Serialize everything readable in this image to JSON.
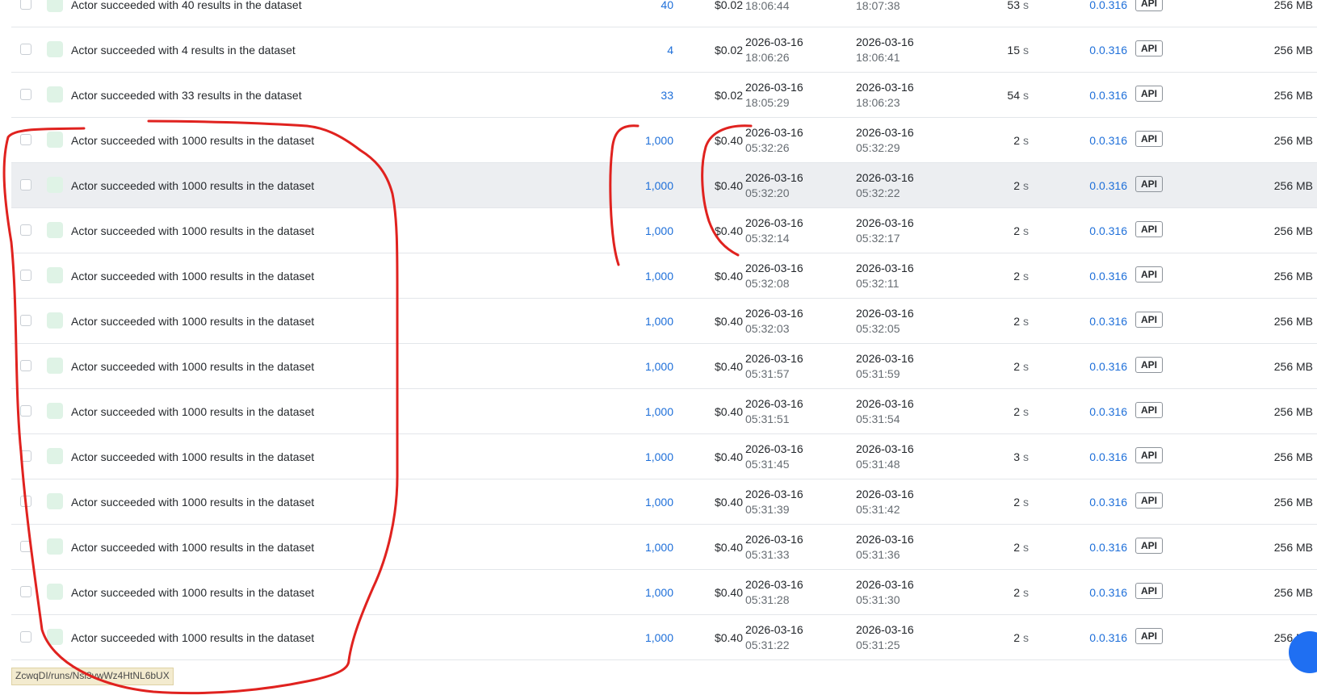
{
  "runs": [
    {
      "status": "Actor succeeded with 40 results in the dataset",
      "results": "40",
      "cost": "$0.02",
      "started_date": "",
      "started_time": "18:06:44",
      "finished_date": "",
      "finished_time": "18:07:38",
      "duration": "53",
      "duration_unit": "s",
      "build": "0.0.316",
      "origin": "API",
      "memory": "256 MB"
    },
    {
      "status": "Actor succeeded with 4 results in the dataset",
      "results": "4",
      "cost": "$0.02",
      "started_date": "2026-03-16",
      "started_time": "18:06:26",
      "finished_date": "2026-03-16",
      "finished_time": "18:06:41",
      "duration": "15",
      "duration_unit": "s",
      "build": "0.0.316",
      "origin": "API",
      "memory": "256 MB"
    },
    {
      "status": "Actor succeeded with 33 results in the dataset",
      "results": "33",
      "cost": "$0.02",
      "started_date": "2026-03-16",
      "started_time": "18:05:29",
      "finished_date": "2026-03-16",
      "finished_time": "18:06:23",
      "duration": "54",
      "duration_unit": "s",
      "build": "0.0.316",
      "origin": "API",
      "memory": "256 MB"
    },
    {
      "status": "Actor succeeded with 1000 results in the dataset",
      "results": "1,000",
      "cost": "$0.40",
      "started_date": "2026-03-16",
      "started_time": "05:32:26",
      "finished_date": "2026-03-16",
      "finished_time": "05:32:29",
      "duration": "2",
      "duration_unit": "s",
      "build": "0.0.316",
      "origin": "API",
      "memory": "256 MB"
    },
    {
      "status": "Actor succeeded with 1000 results in the dataset",
      "results": "1,000",
      "cost": "$0.40",
      "started_date": "2026-03-16",
      "started_time": "05:32:20",
      "finished_date": "2026-03-16",
      "finished_time": "05:32:22",
      "duration": "2",
      "duration_unit": "s",
      "build": "0.0.316",
      "origin": "API",
      "memory": "256 MB"
    },
    {
      "status": "Actor succeeded with 1000 results in the dataset",
      "results": "1,000",
      "cost": "$0.40",
      "started_date": "2026-03-16",
      "started_time": "05:32:14",
      "finished_date": "2026-03-16",
      "finished_time": "05:32:17",
      "duration": "2",
      "duration_unit": "s",
      "build": "0.0.316",
      "origin": "API",
      "memory": "256 MB"
    },
    {
      "status": "Actor succeeded with 1000 results in the dataset",
      "results": "1,000",
      "cost": "$0.40",
      "started_date": "2026-03-16",
      "started_time": "05:32:08",
      "finished_date": "2026-03-16",
      "finished_time": "05:32:11",
      "duration": "2",
      "duration_unit": "s",
      "build": "0.0.316",
      "origin": "API",
      "memory": "256 MB"
    },
    {
      "status": "Actor succeeded with 1000 results in the dataset",
      "results": "1,000",
      "cost": "$0.40",
      "started_date": "2026-03-16",
      "started_time": "05:32:03",
      "finished_date": "2026-03-16",
      "finished_time": "05:32:05",
      "duration": "2",
      "duration_unit": "s",
      "build": "0.0.316",
      "origin": "API",
      "memory": "256 MB"
    },
    {
      "status": "Actor succeeded with 1000 results in the dataset",
      "results": "1,000",
      "cost": "$0.40",
      "started_date": "2026-03-16",
      "started_time": "05:31:57",
      "finished_date": "2026-03-16",
      "finished_time": "05:31:59",
      "duration": "2",
      "duration_unit": "s",
      "build": "0.0.316",
      "origin": "API",
      "memory": "256 MB"
    },
    {
      "status": "Actor succeeded with 1000 results in the dataset",
      "results": "1,000",
      "cost": "$0.40",
      "started_date": "2026-03-16",
      "started_time": "05:31:51",
      "finished_date": "2026-03-16",
      "finished_time": "05:31:54",
      "duration": "2",
      "duration_unit": "s",
      "build": "0.0.316",
      "origin": "API",
      "memory": "256 MB"
    },
    {
      "status": "Actor succeeded with 1000 results in the dataset",
      "results": "1,000",
      "cost": "$0.40",
      "started_date": "2026-03-16",
      "started_time": "05:31:45",
      "finished_date": "2026-03-16",
      "finished_time": "05:31:48",
      "duration": "3",
      "duration_unit": "s",
      "build": "0.0.316",
      "origin": "API",
      "memory": "256 MB"
    },
    {
      "status": "Actor succeeded with 1000 results in the dataset",
      "results": "1,000",
      "cost": "$0.40",
      "started_date": "2026-03-16",
      "started_time": "05:31:39",
      "finished_date": "2026-03-16",
      "finished_time": "05:31:42",
      "duration": "2",
      "duration_unit": "s",
      "build": "0.0.316",
      "origin": "API",
      "memory": "256 MB"
    },
    {
      "status": "Actor succeeded with 1000 results in the dataset",
      "results": "1,000",
      "cost": "$0.40",
      "started_date": "2026-03-16",
      "started_time": "05:31:33",
      "finished_date": "2026-03-16",
      "finished_time": "05:31:36",
      "duration": "2",
      "duration_unit": "s",
      "build": "0.0.316",
      "origin": "API",
      "memory": "256 MB"
    },
    {
      "status": "Actor succeeded with 1000 results in the dataset",
      "results": "1,000",
      "cost": "$0.40",
      "started_date": "2026-03-16",
      "started_time": "05:31:28",
      "finished_date": "2026-03-16",
      "finished_time": "05:31:30",
      "duration": "2",
      "duration_unit": "s",
      "build": "0.0.316",
      "origin": "API",
      "memory": "256 MB"
    },
    {
      "status": "Actor succeeded with 1000 results in the dataset",
      "results": "1,000",
      "cost": "$0.40",
      "started_date": "2026-03-16",
      "started_time": "05:31:22",
      "finished_date": "2026-03-16",
      "finished_time": "05:31:25",
      "duration": "2",
      "duration_unit": "s",
      "build": "0.0.316",
      "origin": "API",
      "memory": "256 MB"
    }
  ],
  "hover_row_index": 4,
  "status_bar_url": "ZcwqDI/runs/Nsl3vwWz4HtNL6bUX",
  "colors": {
    "link": "#1e6fd9",
    "status_icon_bg": "#dff3e6",
    "row_hover": "#eceef1",
    "annotation": "#e0221f",
    "fab": "#1f6ff2"
  },
  "icons": {
    "status": "success-status-icon",
    "fab": "chat-bubble-icon"
  }
}
